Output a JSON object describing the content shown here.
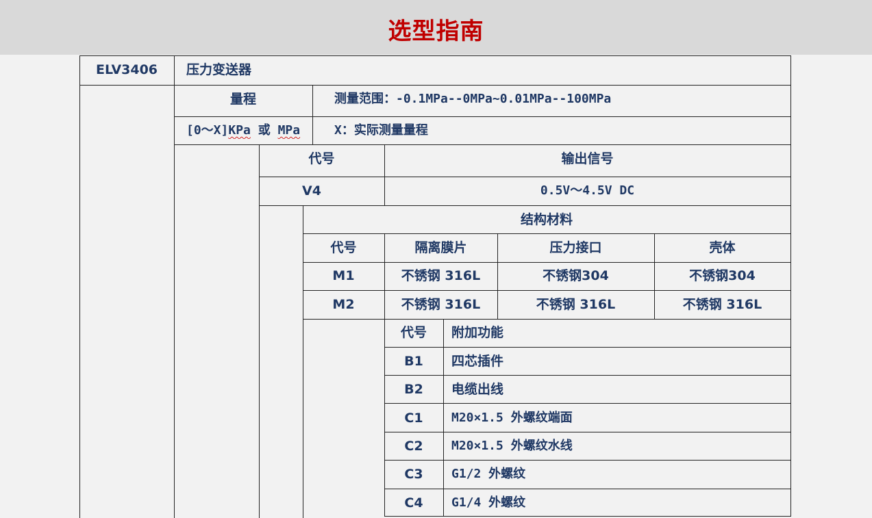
{
  "page": {
    "title": "选型指南"
  },
  "model": {
    "code": "ELV3406",
    "name": "压力变送器"
  },
  "range": {
    "label": "量程",
    "desc": "测量范围：-0.1MPa--0MPa~0.01MPa--100MPa",
    "unit_prefix": "[0～X]",
    "unit_kpa": "KPa",
    "unit_or": "或",
    "unit_mpa": "MPa",
    "unit_note": "X：实际测量量程"
  },
  "output": {
    "header_code": "代号",
    "header_name": "输出信号",
    "rows": [
      {
        "code": "V4",
        "value": "0.5V～4.5V DC"
      }
    ]
  },
  "material": {
    "title": "结构材料",
    "headers": [
      "代号",
      "隔离膜片",
      "压力接口",
      "壳体"
    ],
    "rows": [
      {
        "code": "M1",
        "diaphragm": "不锈钢 316L",
        "port": "不锈钢304",
        "housing": "不锈钢304"
      },
      {
        "code": "M2",
        "diaphragm": "不锈钢 316L",
        "port": "不锈钢 316L",
        "housing": "不锈钢 316L"
      }
    ]
  },
  "addon": {
    "header_code": "代号",
    "header_name": "附加功能",
    "rows": [
      {
        "code": "B1",
        "name": "四芯插件"
      },
      {
        "code": "B2",
        "name": "电缆出线"
      },
      {
        "code": "C1",
        "name": "M20×1.5 外螺纹端面"
      },
      {
        "code": "C2",
        "name": "M20×1.5 外螺纹水线"
      },
      {
        "code": "C3",
        "name": "G1/2 外螺纹"
      },
      {
        "code": "C4",
        "name": "G1/4 外螺纹"
      }
    ]
  }
}
